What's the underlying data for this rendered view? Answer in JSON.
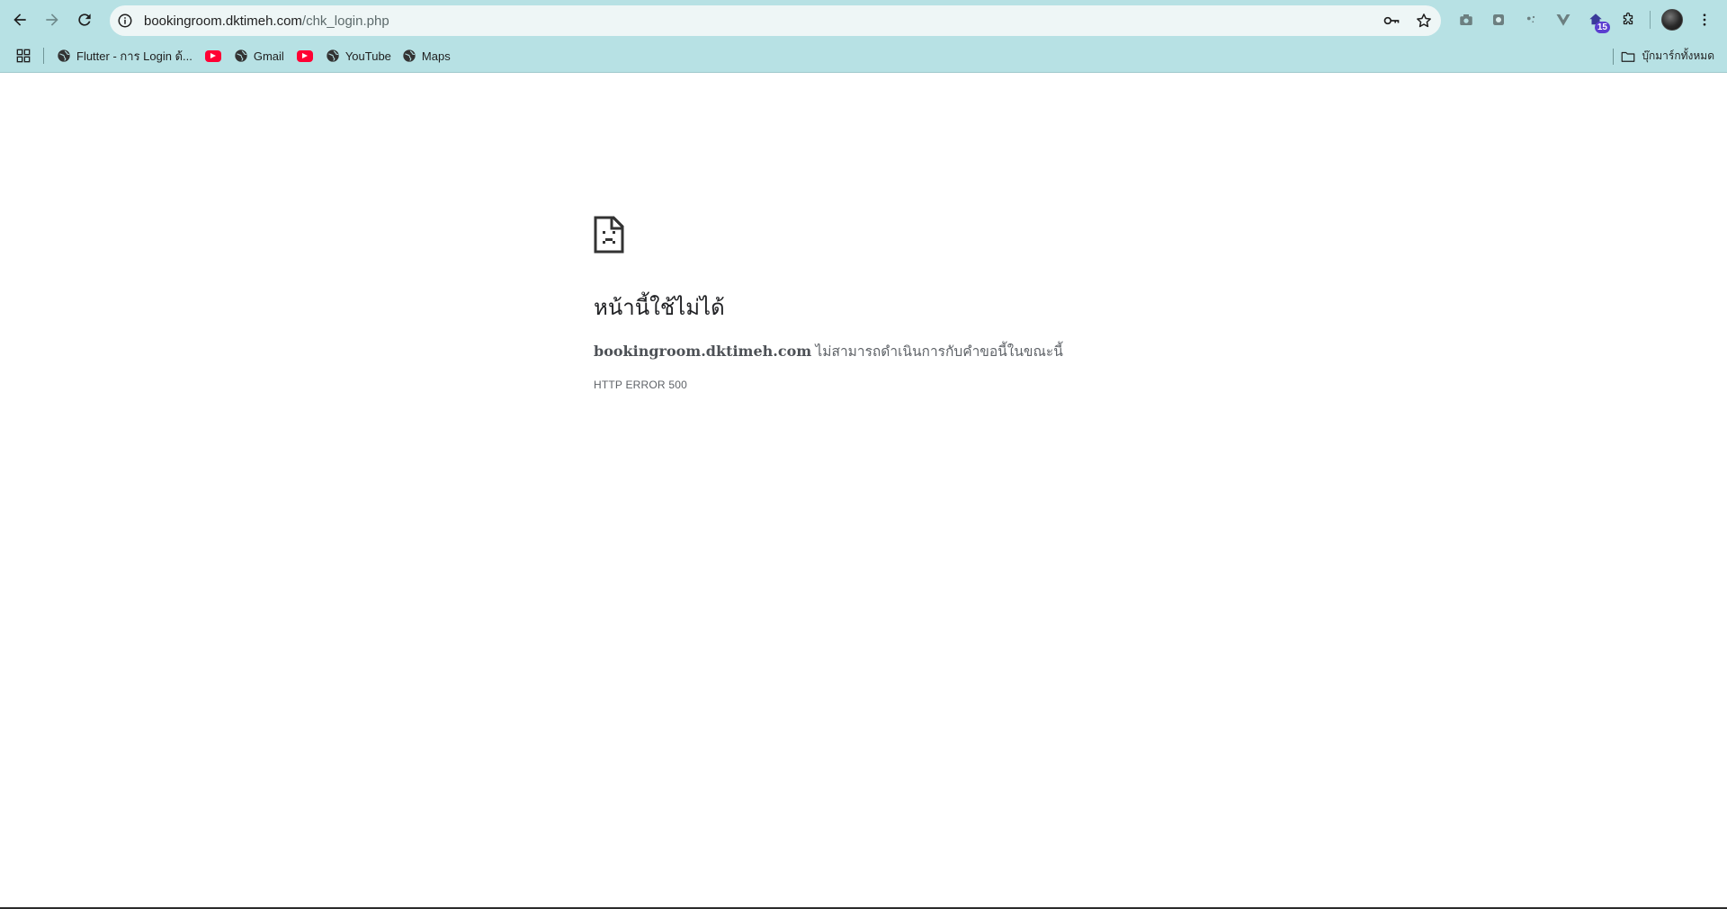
{
  "browser": {
    "url_host": "bookingroom.dktimeh.com",
    "url_path": "/chk_login.php",
    "extension_badge": "15",
    "colors": {
      "toolbar": "#b7e1e4",
      "omnibox": "#eef6f6",
      "badge": "#5b3fd0"
    }
  },
  "bookmarks": {
    "items": [
      {
        "label": "Flutter - การ Login ด้...",
        "icon": "globe-icon"
      },
      {
        "label": "",
        "icon": "youtube-icon"
      },
      {
        "label": "Gmail",
        "icon": "globe-icon"
      },
      {
        "label": "",
        "icon": "youtube-icon"
      },
      {
        "label": "YouTube",
        "icon": "globe-icon"
      },
      {
        "label": "Maps",
        "icon": "globe-icon"
      }
    ],
    "all_bookmarks_label": "บุ๊กมาร์กทั้งหมด"
  },
  "error": {
    "title": "หน้านี้ใช้ไม่ได้",
    "domain": "bookingroom.dktimeh.com",
    "message": " ไม่สามารถดำเนินการกับคำขอนี้ในขณะนี้",
    "code": "HTTP ERROR 500"
  }
}
